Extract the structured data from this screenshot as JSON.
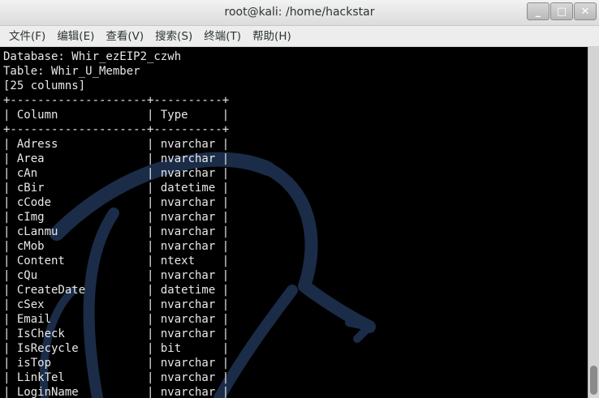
{
  "window": {
    "title": "root@kali: /home/hackstar",
    "controls": {
      "minimize": "_",
      "maximize": "□",
      "close": "✕"
    }
  },
  "menu": {
    "file": "文件(F)",
    "edit": "编辑(E)",
    "view": "查看(V)",
    "search": "搜索(S)",
    "terminal": "终端(T)",
    "help": "帮助(H)"
  },
  "terminal": {
    "lines": [
      "Database: Whir_ezEIP2_czwh",
      "Table: Whir_U_Member",
      "[25 columns]",
      "+--------------------+----------+",
      "| Column             | Type     |",
      "+--------------------+----------+",
      "| Adress             | nvarchar |",
      "| Area               | nvarchar |",
      "| cAn                | nvarchar |",
      "| cBir               | datetime |",
      "| cCode              | nvarchar |",
      "| cImg               | nvarchar |",
      "| cLanmu             | nvarchar |",
      "| cMob               | nvarchar |",
      "| Content            | ntext    |",
      "| cQu                | nvarchar |",
      "| CreateDate         | datetime |",
      "| cSex               | nvarchar |",
      "| Email              | nvarchar |",
      "| IsCheck            | nvarchar |",
      "| IsRecycle          | bit      |",
      "| isTop              | nvarchar |",
      "| LinkTel            | nvarchar |",
      "| LoginName          | nvarchar |"
    ]
  },
  "colors": {
    "terminal_background": "#000000",
    "terminal_text": "#e8e8e8",
    "wallpaper_dragon": "#1b2c48"
  }
}
